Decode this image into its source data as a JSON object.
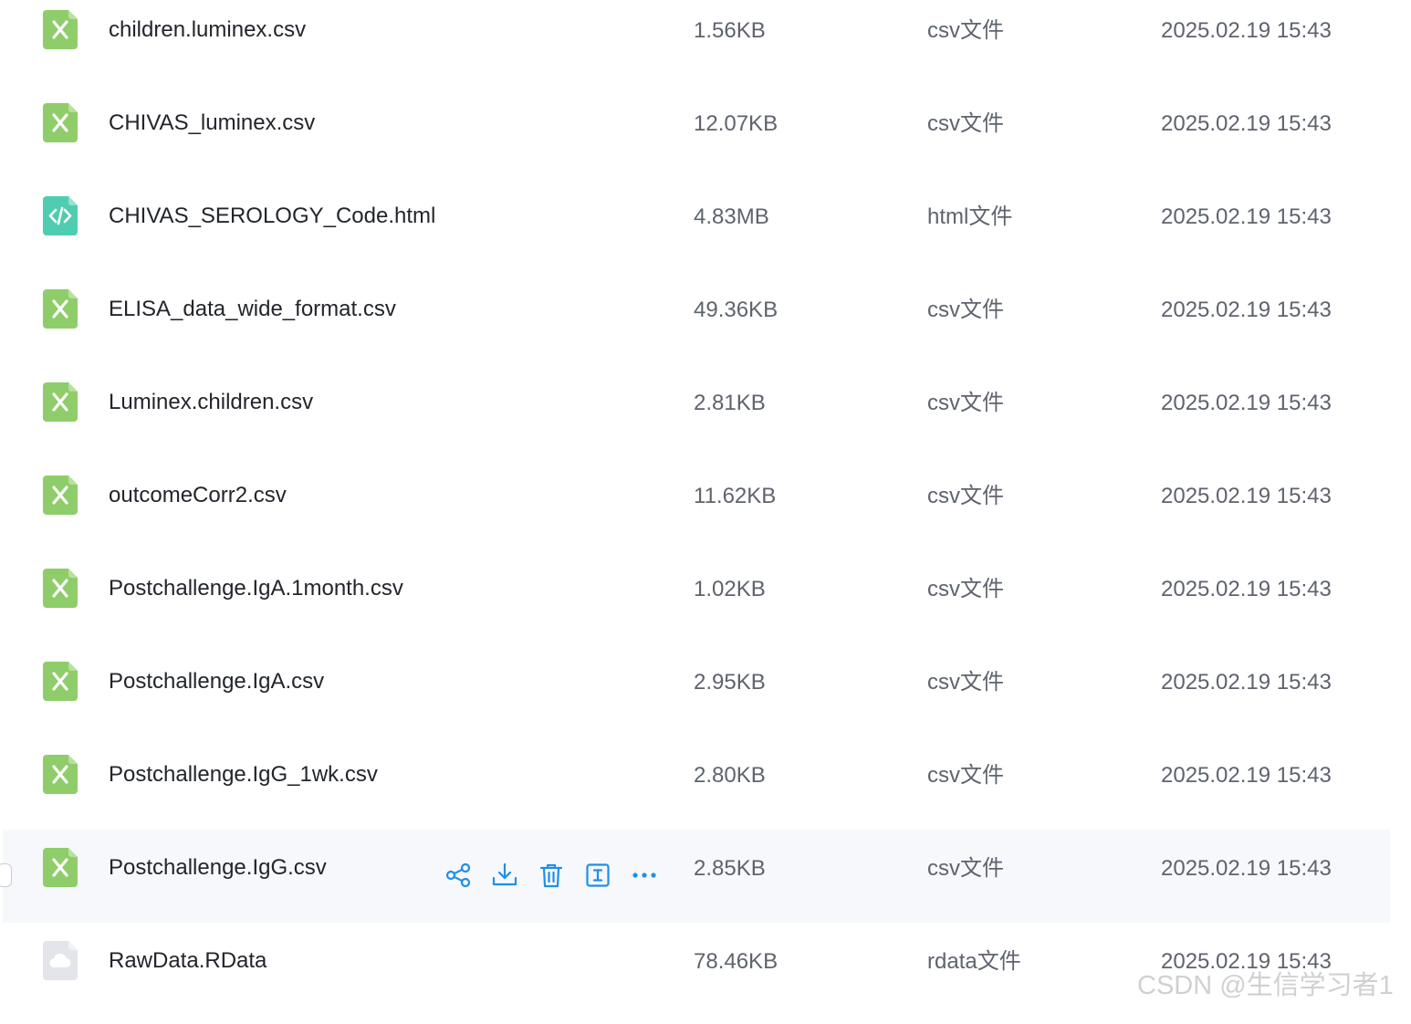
{
  "colors": {
    "csv_icon": "#8fcd6a",
    "html_icon": "#4fcdb0",
    "rdata_icon": "#e3e5ea",
    "action_icon": "#1f8fe6",
    "hover_row": "#f6f8fc"
  },
  "files": [
    {
      "name": "children.luminex.csv",
      "size": "1.56KB",
      "type": "csv文件",
      "date": "2025.02.19 15:43",
      "icon": "excel-icon"
    },
    {
      "name": "CHIVAS_luminex.csv",
      "size": "12.07KB",
      "type": "csv文件",
      "date": "2025.02.19 15:43",
      "icon": "excel-icon"
    },
    {
      "name": "CHIVAS_SEROLOGY_Code.html",
      "size": "4.83MB",
      "type": "html文件",
      "date": "2025.02.19 15:43",
      "icon": "code-icon"
    },
    {
      "name": "ELISA_data_wide_format.csv",
      "size": "49.36KB",
      "type": "csv文件",
      "date": "2025.02.19 15:43",
      "icon": "excel-icon"
    },
    {
      "name": "Luminex.children.csv",
      "size": "2.81KB",
      "type": "csv文件",
      "date": "2025.02.19 15:43",
      "icon": "excel-icon"
    },
    {
      "name": "outcomeCorr2.csv",
      "size": "11.62KB",
      "type": "csv文件",
      "date": "2025.02.19 15:43",
      "icon": "excel-icon"
    },
    {
      "name": "Postchallenge.IgA.1month.csv",
      "size": "1.02KB",
      "type": "csv文件",
      "date": "2025.02.19 15:43",
      "icon": "excel-icon"
    },
    {
      "name": "Postchallenge.IgA.csv",
      "size": "2.95KB",
      "type": "csv文件",
      "date": "2025.02.19 15:43",
      "icon": "excel-icon"
    },
    {
      "name": "Postchallenge.IgG_1wk.csv",
      "size": "2.80KB",
      "type": "csv文件",
      "date": "2025.02.19 15:43",
      "icon": "excel-icon"
    },
    {
      "name": "Postchallenge.IgG.csv",
      "size": "2.85KB",
      "type": "csv文件",
      "date": "2025.02.19 15:43",
      "icon": "excel-icon"
    },
    {
      "name": "RawData.RData",
      "size": "78.46KB",
      "type": "rdata文件",
      "date": "2025.02.19 15:43",
      "icon": "cloud-file-icon"
    }
  ],
  "hovered_row": 9,
  "row_actions": [
    "share-icon",
    "download-icon",
    "delete-icon",
    "rename-icon",
    "more-icon"
  ],
  "watermark": "CSDN @生信学习者1"
}
